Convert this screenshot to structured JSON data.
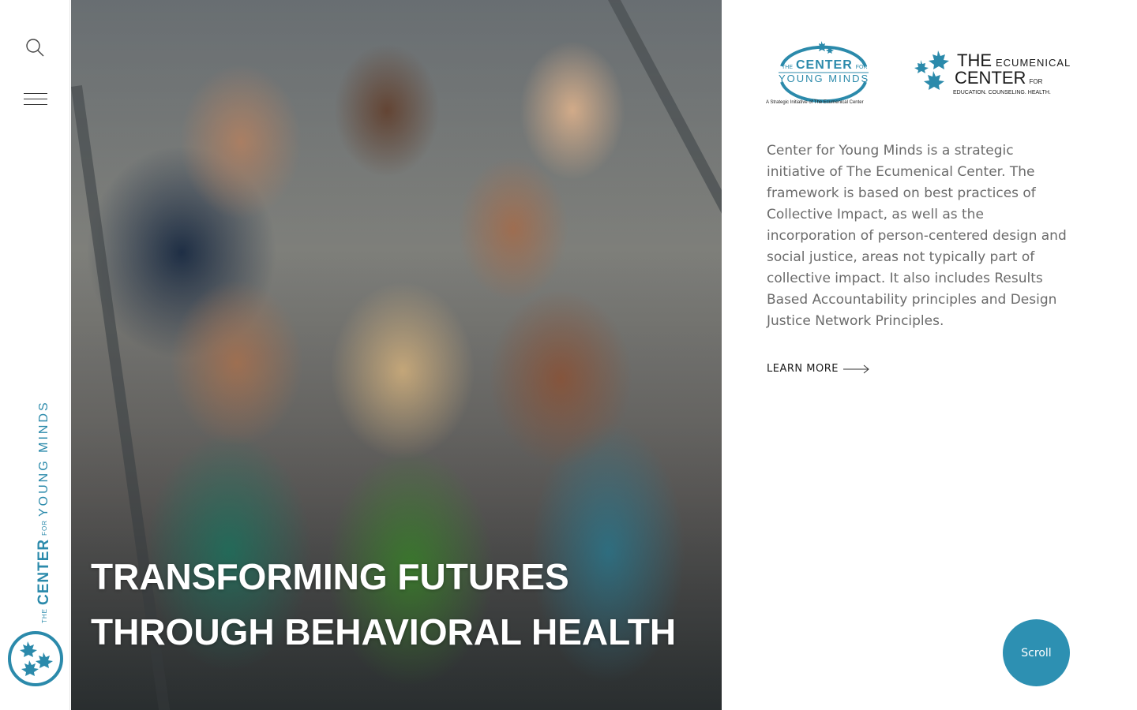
{
  "sidebar": {
    "brand_the": "THE",
    "brand_center": "CENTER",
    "brand_for": "FOR",
    "brand_young_minds": "YOUNG MINDS"
  },
  "hero": {
    "title_line1": "TRANSFORMING FUTURES",
    "title_line2": "THROUGH BEHAVIORAL HEALTH"
  },
  "logos": {
    "cym": {
      "the": "THE",
      "center": "CENTER",
      "for": "FOR",
      "young_minds": "YOUNG MINDS",
      "tagline": "A Strategic Initiative of The Ecumenical Center"
    },
    "ec": {
      "the": "THE",
      "ecumenical": "ECUMENICAL",
      "center": "CENTER",
      "for": "FOR",
      "tagline": "EDUCATION. COUNSELING. HEALTH."
    }
  },
  "intro": {
    "description": "Center for Young Minds is a strategic initiative of The Ecumenical Center. The framework is based on best practices of Collective Impact, as well as the incorporation of person-centered design and social justice, areas not typically part of collective impact. It also includes Results Based Accountability principles and Design Justice Network Principles.",
    "learn_more": "LEARN MORE"
  },
  "scroll_label": "Scroll",
  "colors": {
    "brand_teal": "#2b8aab",
    "scroll_button": "#2d90b2",
    "body_text": "#6b6b6b"
  },
  "icons": {
    "search": "search-icon",
    "menu": "hamburger-menu-icon",
    "arrow": "arrow-right-icon",
    "leaf": "maple-leaf-icon"
  }
}
